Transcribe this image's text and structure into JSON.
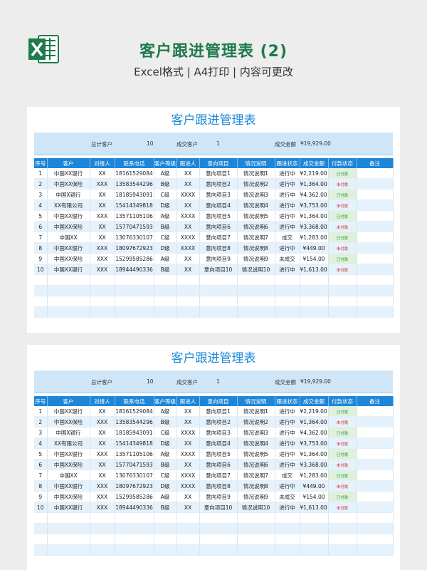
{
  "header": {
    "title": "客户跟进管理表 (2)",
    "subtitle": "Excel格式 | A4打印 | 内容可更改",
    "icon": "excel-icon",
    "brand_color": "#1f7a4c"
  },
  "sheet": {
    "title": "客户跟进管理表",
    "summary": {
      "total_label": "总计客户",
      "total_value": "10",
      "deal_label": "成交客户",
      "deal_value": "1",
      "amount_label": "成交金额",
      "amount_value": "¥19,929.00"
    },
    "columns": [
      "序号",
      "客户",
      "对接人",
      "联系电话",
      "客户等级",
      "跟进人",
      "意向项目",
      "情况说明",
      "跟进状态",
      "成交金额",
      "付款状态",
      "备注"
    ],
    "rows": [
      [
        "1",
        "中国XX银行",
        "XX",
        "18161529084",
        "A级",
        "XX",
        "意向项目1",
        "情况说明1",
        "进行中",
        "¥2,219.00",
        "已付款",
        ""
      ],
      [
        "2",
        "中国XX保险",
        "XXX",
        "13583544296",
        "B级",
        "XX",
        "意向项目2",
        "情况说明2",
        "进行中",
        "¥1,364.00",
        "未付款",
        ""
      ],
      [
        "3",
        "中国X银行",
        "XX",
        "18185943091",
        "C级",
        "XXXX",
        "意向项目3",
        "情况说明3",
        "进行中",
        "¥4,362.00",
        "已付款",
        ""
      ],
      [
        "4",
        "XX有限公司",
        "XX",
        "15414349818",
        "D级",
        "XX",
        "意向项目4",
        "情况说明4",
        "进行中",
        "¥3,753.00",
        "未付款",
        ""
      ],
      [
        "5",
        "中国XX银行",
        "XXX",
        "13571105106",
        "A级",
        "XXXX",
        "意向项目5",
        "情况说明5",
        "进行中",
        "¥1,364.00",
        "已付款",
        ""
      ],
      [
        "6",
        "中国XX保险",
        "XX",
        "15770471593",
        "B级",
        "XX",
        "意向项目6",
        "情况说明6",
        "进行中",
        "¥3,368.00",
        "未付款",
        ""
      ],
      [
        "7",
        "中国XX",
        "XX",
        "13076330107",
        "C级",
        "XXXX",
        "意向项目7",
        "情况说明7",
        "成交",
        "¥1,283.00",
        "已付款",
        ""
      ],
      [
        "8",
        "中国XX银行",
        "XXX",
        "18097672923",
        "D级",
        "XXXX",
        "意向项目8",
        "情况说明8",
        "进行中",
        "¥449.00",
        "未付款",
        ""
      ],
      [
        "9",
        "中国XX保险",
        "XXX",
        "15299585286",
        "A级",
        "XX",
        "意向项目9",
        "情况说明9",
        "未成交",
        "¥154.00",
        "已付款",
        ""
      ],
      [
        "10",
        "中国XX银行",
        "XXX",
        "18944490336",
        "B级",
        "XX",
        "意向项目10",
        "情况说明10",
        "进行中",
        "¥1,613.00",
        "未付款",
        ""
      ]
    ],
    "empty_rows": 4,
    "colors": {
      "title": "#1c8ad8",
      "header_bg": "#1e86d8",
      "summary_bg": "#cfe6f8",
      "row_alt": "#e5f1fb",
      "paid": "#2e9a3b",
      "unpaid": "#d0302c",
      "paid_bg": "#dff1dc"
    }
  }
}
